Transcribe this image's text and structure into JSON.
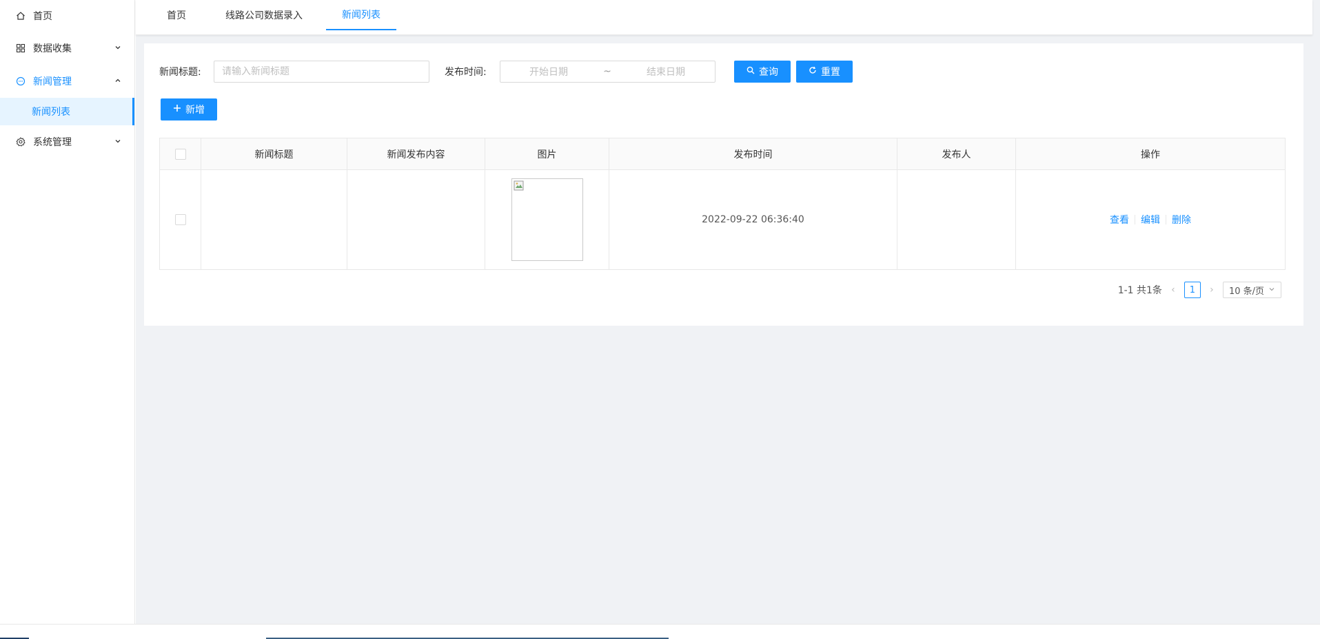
{
  "sidebar": {
    "items": [
      {
        "label": "首页",
        "icon": "home-icon",
        "expanded": false
      },
      {
        "label": "数据收集",
        "icon": "grid-icon",
        "expanded": false
      },
      {
        "label": "新闻管理",
        "icon": "message-icon",
        "expanded": true,
        "children": [
          {
            "label": "新闻列表",
            "active": true
          }
        ]
      },
      {
        "label": "系统管理",
        "icon": "gear-icon",
        "expanded": false
      }
    ]
  },
  "tabs": [
    {
      "label": "首页",
      "active": false
    },
    {
      "label": "线路公司数据录入",
      "active": false
    },
    {
      "label": "新闻列表",
      "active": true
    }
  ],
  "search": {
    "title_label": "新闻标题:",
    "title_placeholder": "请输入新闻标题",
    "title_value": "",
    "date_label": "发布时间:",
    "date_start_placeholder": "开始日期",
    "date_separator": "~",
    "date_end_placeholder": "结束日期",
    "query_button": "查询",
    "reset_button": "重置"
  },
  "toolbar": {
    "add_button": "新增"
  },
  "table": {
    "columns": [
      "新闻标题",
      "新闻发布内容",
      "图片",
      "发布时间",
      "发布人",
      "操作"
    ],
    "rows": [
      {
        "title": "",
        "content": "",
        "image": "broken-image",
        "publish_time": "2022-09-22 06:36:40",
        "publisher": "",
        "actions": [
          "查看",
          "编辑",
          "删除"
        ]
      }
    ]
  },
  "pagination": {
    "summary": "1-1 共1条",
    "current_page": "1",
    "page_size": "10 条/页"
  },
  "colors": {
    "primary": "#1890ff",
    "sidebar_active_bg": "#e6f4ff",
    "page_bg": "#f0f2f5",
    "border": "#e8e8e8"
  }
}
